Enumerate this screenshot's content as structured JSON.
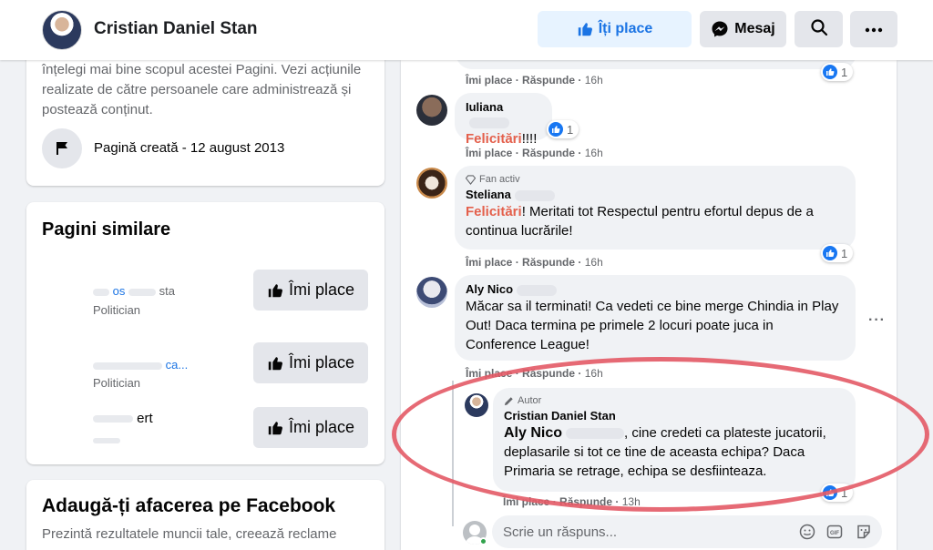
{
  "header": {
    "page_name": "Cristian Daniel Stan",
    "like_label": "Îți place",
    "message_label": "Mesaj"
  },
  "about": {
    "description": "înțelegi mai bine scopul acestei Pagini. Vezi acțiunile realizate de către persoanele care administrează și postează conținut.",
    "created": "Pagină creată - 12 august 2013"
  },
  "similar": {
    "title": "Pagini similare",
    "items": [
      {
        "name_partial": "os",
        "name_partial2": "sta",
        "category": "Politician",
        "button": "Îmi place"
      },
      {
        "name_partial": "ca...",
        "category": "Politician",
        "button": "Îmi place"
      },
      {
        "name_partial": "ert",
        "category": "",
        "button": "Îmi place"
      }
    ]
  },
  "business": {
    "title": "Adaugă-ți afacerea pe Facebook",
    "desc": "Prezintă rezultatele muncii tale, creează reclame"
  },
  "comments": [
    {
      "actions": {
        "like": "Îmi place",
        "reply": "Răspunde",
        "time": "16h"
      },
      "reactions": "1"
    },
    {
      "name": "Iuliana",
      "text_hl": "Felicitări",
      "text": "!!!!",
      "reactions": "1",
      "actions": {
        "like": "Îmi place",
        "reply": "Răspunde",
        "time": "16h"
      }
    },
    {
      "badge": "Fan activ",
      "name": "Steliana",
      "text_hl": "Felicitări",
      "text": "! Meritati tot Respectul pentru efortul depus de a continua lucrările!",
      "reactions": "1",
      "actions": {
        "like": "Îmi place",
        "reply": "Răspunde",
        "time": "16h"
      }
    },
    {
      "name": "Aly Nico",
      "text": "Măcar sa il terminati! Ca vedeti ce bine merge Chindia in Play Out! Daca termina pe primele 2 locuri poate juca in Conference League!",
      "actions": {
        "like": "Îmi place",
        "reply": "Răspunde",
        "time": "16h"
      }
    }
  ],
  "reply": {
    "badge": "Autor",
    "name": "Cristian Daniel Stan",
    "mention": "Aly Nico",
    "text": ", cine credeti ca plateste jucatorii, deplasarile si tot ce tine de aceasta echipa? Daca Primaria se retrage, echipa se desfiinteaza.",
    "reactions": "1",
    "actions": {
      "like": "Îmi place",
      "reply": "Răspunde",
      "time": "13h"
    }
  },
  "reply_input": {
    "placeholder": "Scrie un răspuns..."
  },
  "colors": {
    "accent": "#1b74e4",
    "highlight": "#e4604c",
    "annotation": "#e35a66"
  }
}
